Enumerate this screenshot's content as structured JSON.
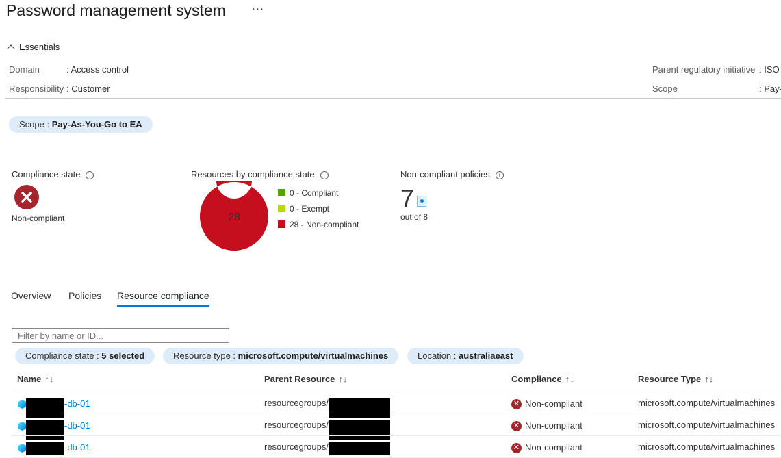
{
  "header": {
    "title": "Password management system",
    "more": "···"
  },
  "essentials": {
    "toggle_label": "Essentials",
    "domain_label": "Domain",
    "domain_value": ": Access control",
    "responsibility_label": "Responsibility",
    "responsibility_value": ": Customer",
    "parent_label": "Parent regulatory initiative",
    "parent_value": ": ISO",
    "scope_label": "Scope",
    "scope_value": ": Pay-"
  },
  "scope_pill": {
    "label": "Scope : ",
    "value": "Pay-As-You-Go to EA"
  },
  "compliance_state": {
    "title": "Compliance state",
    "value": "Non-compliant",
    "icon": "error-circle-icon",
    "color": "#a4262c"
  },
  "resources_by_state": {
    "title": "Resources by compliance state",
    "total": "28",
    "legend": [
      {
        "label": "0 - Compliant",
        "color": "#57a300"
      },
      {
        "label": "0 - Exempt",
        "color": "#bad80a"
      },
      {
        "label": "28 - Non-compliant",
        "color": "#c50f1f"
      }
    ]
  },
  "chart_data": {
    "type": "pie",
    "categories": [
      "0 - Compliant",
      "0 - Exempt",
      "28 - Non-compliant"
    ],
    "values": [
      0,
      0,
      28
    ],
    "colors": [
      "#57a300",
      "#bad80a",
      "#c50f1f"
    ],
    "title": "Resources by compliance state",
    "center_label": "28"
  },
  "non_compliant_policies": {
    "title": "Non-compliant policies",
    "count": "7",
    "sub": "out of 8"
  },
  "tabs": [
    {
      "label": "Overview"
    },
    {
      "label": "Policies"
    },
    {
      "label": "Resource compliance",
      "active": true
    }
  ],
  "filter": {
    "placeholder": "Filter by name or ID..."
  },
  "filter_pills": [
    {
      "label": "Compliance state : ",
      "value": "5 selected"
    },
    {
      "label": "Resource type : ",
      "value": "microsoft.compute/virtualmachines"
    },
    {
      "label": "Location : ",
      "value": "australiaeast"
    }
  ],
  "table": {
    "columns": [
      "Name",
      "Parent Resource",
      "Compliance",
      "Resource Type"
    ],
    "sort_glyph": "↑↓",
    "rows": [
      {
        "name": "-db-01",
        "parent": "resourcegroups/",
        "compliance": "Non-compliant",
        "type": "microsoft.compute/virtualmachines"
      },
      {
        "name": "-db-01",
        "parent": "resourcegroups/",
        "compliance": "Non-compliant",
        "type": "microsoft.compute/virtualmachines"
      },
      {
        "name": "-db-01",
        "parent": "resourcegroups/",
        "compliance": "Non-compliant",
        "type": "microsoft.compute/virtualmachines"
      }
    ]
  }
}
